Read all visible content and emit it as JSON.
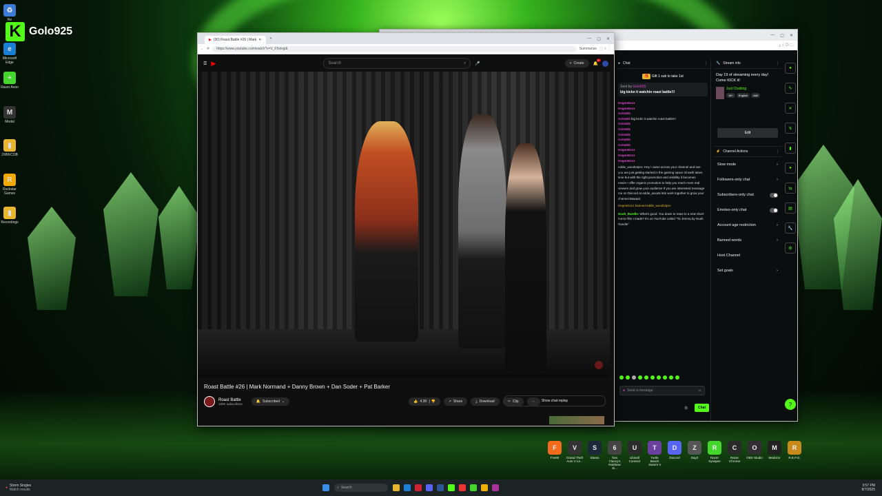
{
  "desktop": {
    "brand_name": "Golo925",
    "icons": [
      {
        "label": "Re",
        "color": "#3a7bd5",
        "glyph": "♻"
      },
      {
        "label": "Microsoft Edge",
        "color": "#1b7fd6",
        "glyph": "e"
      },
      {
        "label": "Razer Axon",
        "color": "#44d62c",
        "glyph": "+"
      },
      {
        "label": "Medal",
        "color": "#333333",
        "glyph": "M"
      },
      {
        "label": "2XBKCOB",
        "color": "#e8b52f",
        "glyph": "▮"
      },
      {
        "label": "Rockstar Games",
        "color": "#f2a900",
        "glyph": "R"
      },
      {
        "label": "Recordings",
        "color": "#e8b52f",
        "glyph": "▮"
      }
    ]
  },
  "youtube_window": {
    "tab_title": "(30) Roast Battle #26 | Mark",
    "url": "https://www.youtube.com/watch?v=V_F5stvjpE",
    "summarize_label": "Summarize",
    "search_placeholder": "Search",
    "create_label": "Create",
    "notif_count": "9+",
    "video_title": "Roast Battle #26 | Mark Normand + Danny Brown + Dan Soder + Pat Barker",
    "channel_name": "Roast Battle",
    "subscribers": "100K subscribers",
    "subscribed_label": "Subscribed",
    "like_count": "4.3K",
    "share_label": "Share",
    "download_label": "Download",
    "clip_label": "Clip",
    "more_label": "···",
    "chat_replay_label": "Show chat replay"
  },
  "kick_window": {
    "chat_title": "Chat",
    "gift_banner": "Gift 1 sub to take 1st",
    "pinned_by": "Sent by",
    "pinned_message": "big kickn it watchin roast battle!!!",
    "chat_lines": [
      {
        "user": "DegenDocz",
        "text": "",
        "style": "u"
      },
      {
        "user": "DegenDocz",
        "text": "",
        "style": "u"
      },
      {
        "user": "Golo925",
        "text": "",
        "style": "u"
      },
      {
        "user": "Golo925",
        "text": "big kickn it watchin roast battle!!!",
        "style": "u"
      },
      {
        "user": "Golo925",
        "text": "",
        "style": "u"
      },
      {
        "user": "Golo925",
        "text": "",
        "style": "u"
      },
      {
        "user": "Golo925",
        "text": "",
        "style": "u"
      },
      {
        "user": "Golo925",
        "text": "",
        "style": "u"
      },
      {
        "user": "Golo925",
        "text": "",
        "style": "u"
      },
      {
        "user": "DegenDocz",
        "text": "",
        "style": "u"
      },
      {
        "user": "DegenDocz",
        "text": "",
        "style": "u"
      },
      {
        "user": "DegenDocz",
        "text": "",
        "style": "u"
      }
    ],
    "spam_message": "eddie_woods3pro: Hey I came across your channel and see you are just getting started in the gaming space Growth takes time but with the right promotion and visibility it becomes easier I offer organic promotion to help you reach more real viewers and grow your audience If you are interested message me on Discord at eddie_woods lets work together to grow your channel Bawaal.",
    "ban_notice": "DegenDocz banned eddie_woods3pro",
    "noah_user": "Noah_Randle:",
    "noah_message": "What's good. You down to react to a new short horror film I made? It's on YouTube called \"Tic Emma by Noah Randle\"",
    "message_placeholder": "Send a message",
    "chat_button": "Chat",
    "stream_info_title": "Stream info",
    "stream_title": "Day 19 of streaming every day! Come KICK it!",
    "category": "Just Chatting",
    "tags": [
      "18+",
      "English",
      "chill"
    ],
    "edit_label": "Edit",
    "channel_actions_title": "Channel Actions",
    "actions": [
      {
        "label": "Slow mode",
        "kind": "chevron"
      },
      {
        "label": "Followers-only chat",
        "kind": "chevron"
      },
      {
        "label": "Subscribers-only chat",
        "kind": "toggle"
      },
      {
        "label": "Emotes-only chat",
        "kind": "toggle"
      },
      {
        "label": "Account age restriction",
        "kind": "chevron"
      },
      {
        "label": "Banned words",
        "kind": "chevron"
      },
      {
        "label": "Host Channel",
        "kind": "none"
      },
      {
        "label": "Set goals",
        "kind": "chevron"
      }
    ]
  },
  "dock": [
    {
      "label": "FiveM",
      "color": "#f26a1b",
      "glyph": "F"
    },
    {
      "label": "Grand Theft Auto V Le...",
      "color": "#333333",
      "glyph": "V"
    },
    {
      "label": "Steam",
      "color": "#1b2838",
      "glyph": "S"
    },
    {
      "label": "Tom Clancy's Rainbow Si...",
      "color": "#444444",
      "glyph": "6"
    },
    {
      "label": "Ubisoft Connect",
      "color": "#2b2b2b",
      "glyph": "U"
    },
    {
      "label": "Turtle Beach Swarm II",
      "color": "#6b3fa0",
      "glyph": "T"
    },
    {
      "label": "Discord",
      "color": "#5865f2",
      "glyph": "D"
    },
    {
      "label": "DayZ",
      "color": "#555555",
      "glyph": "Z"
    },
    {
      "label": "Razer Synapse",
      "color": "#44d62c",
      "glyph": "R"
    },
    {
      "label": "Razer Chroma",
      "color": "#2a2a2a",
      "glyph": "C"
    },
    {
      "label": "OBS Studio",
      "color": "#302e31",
      "glyph": "O"
    },
    {
      "label": "Medal.tv",
      "color": "#222222",
      "glyph": "M"
    },
    {
      "label": "R.E.P.O.",
      "color": "#c88a1a",
      "glyph": "R"
    }
  ],
  "taskbar": {
    "weather_title": "Storm Singles",
    "weather_sub": "Match results",
    "search_placeholder": "Search",
    "time": "3:57 PM",
    "date": "8/7/2025"
  }
}
